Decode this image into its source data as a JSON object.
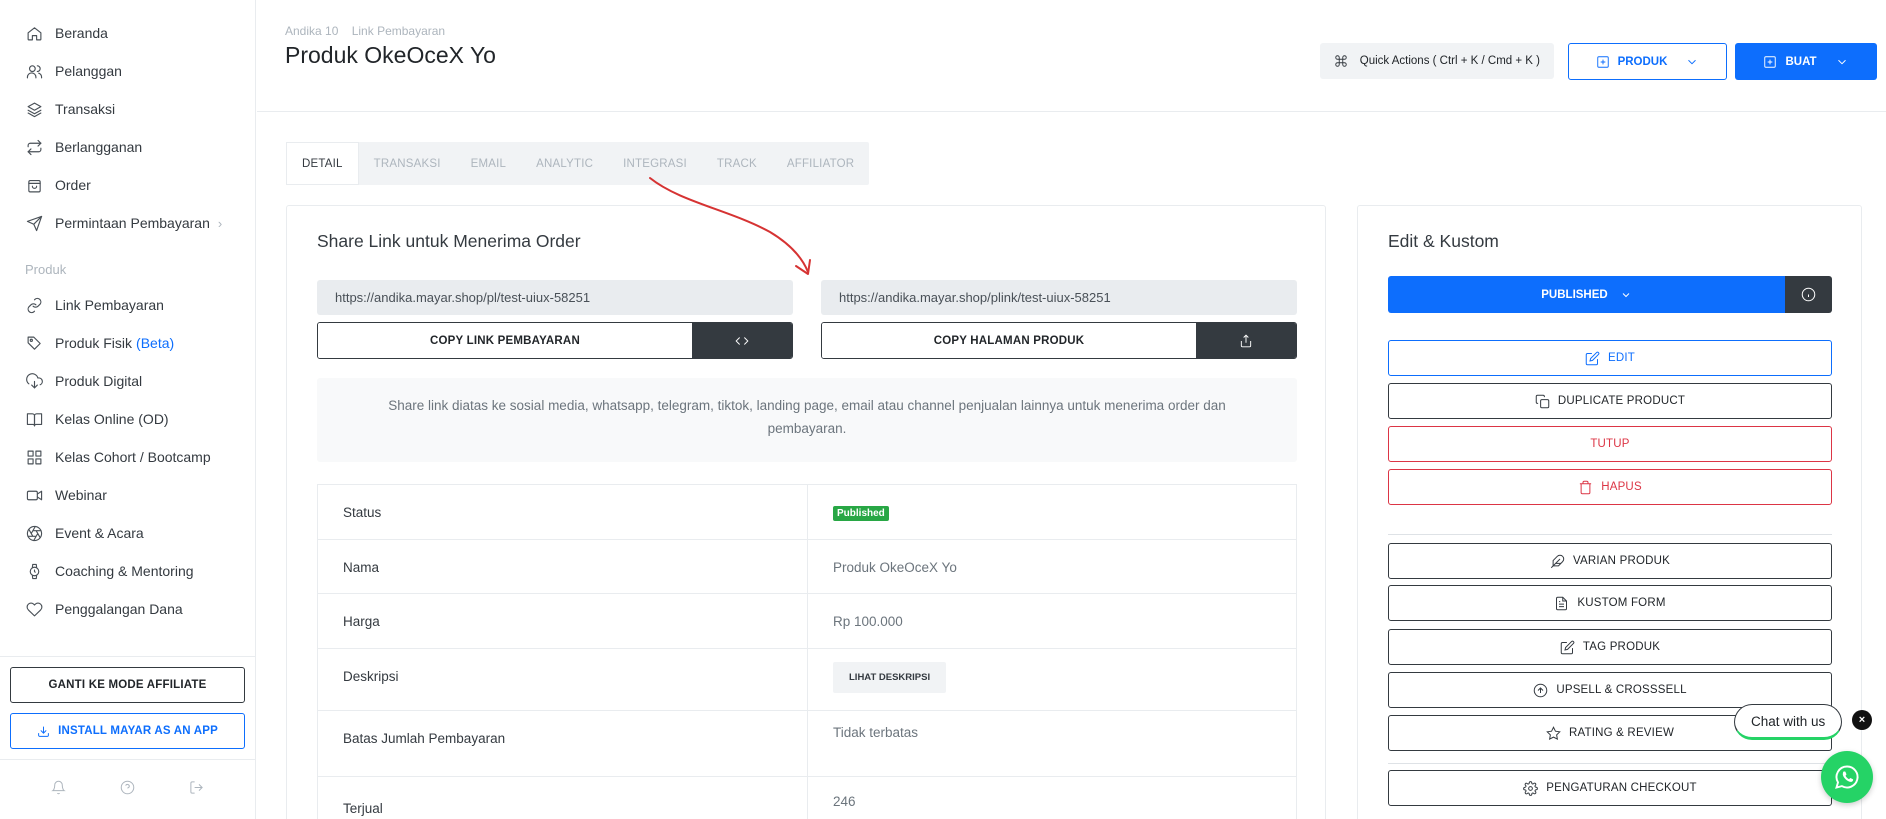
{
  "sidebar": {
    "items": [
      {
        "label": "Beranda",
        "icon": "home-icon"
      },
      {
        "label": "Pelanggan",
        "icon": "users-icon"
      },
      {
        "label": "Transaksi",
        "icon": "layers-icon"
      },
      {
        "label": "Berlangganan",
        "icon": "repeat-icon"
      },
      {
        "label": "Order",
        "icon": "shopping-bag-icon"
      },
      {
        "label": "Permintaan Pembayaran",
        "icon": "send-icon",
        "chevron": "›"
      }
    ],
    "section_label": "Produk",
    "produk_items": [
      {
        "label": "Link Pembayaran",
        "icon": "link-icon"
      },
      {
        "label": "Produk Fisik",
        "beta": "(Beta)",
        "icon": "tag-icon"
      },
      {
        "label": "Produk Digital",
        "icon": "cloud-download-icon"
      },
      {
        "label": "Kelas Online (OD)",
        "icon": "book-icon"
      },
      {
        "label": "Kelas Cohort / Bootcamp",
        "icon": "grid-icon"
      },
      {
        "label": "Webinar",
        "icon": "video-icon"
      },
      {
        "label": "Event & Acara",
        "icon": "aperture-icon"
      },
      {
        "label": "Coaching & Mentoring",
        "icon": "watch-icon"
      },
      {
        "label": "Penggalangan Dana",
        "icon": "heart-icon"
      }
    ],
    "affiliate_button": "GANTI KE MODE AFFILIATE",
    "install_button": "INSTALL MAYAR AS AN APP"
  },
  "header": {
    "breadcrumb": [
      "Andika 10",
      "Link Pembayaran"
    ],
    "title": "Produk OkeOceX Yo",
    "quick_actions": "Quick Actions ( Ctrl + K / Cmd + K )",
    "produk_button": "PRODUK",
    "buat_button": "BUAT"
  },
  "tabs": [
    "DETAIL",
    "TRANSAKSI",
    "EMAIL",
    "ANALYTIC",
    "INTEGRASI",
    "TRACK",
    "AFFILIATOR"
  ],
  "share": {
    "title": "Share Link untuk Menerima Order",
    "link_payment": "https://andika.mayar.shop/pl/test-uiux-58251",
    "link_product": "https://andika.mayar.shop/plink/test-uiux-58251",
    "copy_payment": "COPY LINK PEMBAYARAN",
    "copy_product": "COPY HALAMAN PRODUK",
    "info": "Share link diatas ke sosial media, whatsapp, telegram, tiktok, landing page, email atau channel penjualan lainnya untuk menerima order dan pembayaran."
  },
  "details": {
    "status_label": "Status",
    "status_value": "Published",
    "nama_label": "Nama",
    "nama_value": "Produk OkeOceX Yo",
    "harga_label": "Harga",
    "harga_value": "Rp 100.000",
    "deskripsi_label": "Deskripsi",
    "deskripsi_button": "LIHAT DESKRIPSI",
    "batas_label": "Batas Jumlah Pembayaran",
    "batas_value": "Tidak terbatas",
    "terjual_label": "Terjual",
    "terjual_value": "246"
  },
  "edit": {
    "title": "Edit & Kustom",
    "published": "PUBLISHED",
    "edit": "EDIT",
    "duplicate": "DUPLICATE PRODUCT",
    "tutup": "TUTUP",
    "hapus": "HAPUS",
    "varian": "VARIAN PRODUK",
    "kustom_form": "KUSTOM FORM",
    "tag": "TAG PRODUK",
    "upsell": "UPSELL & CROSSSELL",
    "rating": "RATING & REVIEW",
    "checkout": "PENGATURAN CHECKOUT"
  },
  "chat": {
    "label": "Chat with us",
    "close": "×"
  },
  "colors": {
    "primary": "#0d6efd",
    "dark": "#343a40",
    "danger": "#dc3545",
    "success": "#28a745",
    "whatsapp": "#25d366"
  }
}
